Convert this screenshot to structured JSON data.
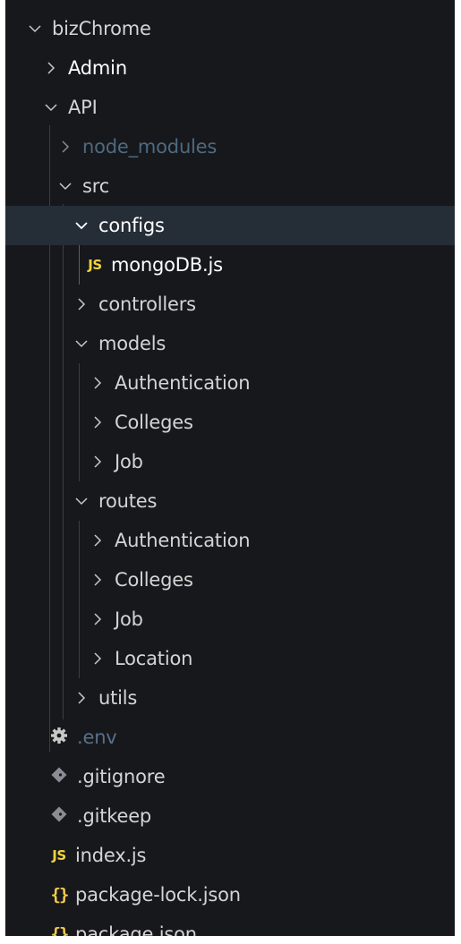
{
  "explorer": {
    "items": [
      {
        "label": "bizChrome",
        "type": "folder",
        "expanded": true
      },
      {
        "label": "Admin",
        "type": "folder",
        "expanded": false
      },
      {
        "label": "API",
        "type": "folder",
        "expanded": true
      },
      {
        "label": "node_modules",
        "type": "folder",
        "expanded": false
      },
      {
        "label": "src",
        "type": "folder",
        "expanded": true
      },
      {
        "label": "configs",
        "type": "folder",
        "expanded": true,
        "selected": true
      },
      {
        "label": "mongoDB.js",
        "type": "file",
        "icon": "js-file-icon",
        "icon_text": "JS"
      },
      {
        "label": "controllers",
        "type": "folder",
        "expanded": false
      },
      {
        "label": "models",
        "type": "folder",
        "expanded": true
      },
      {
        "label": "Authentication",
        "type": "folder",
        "expanded": false
      },
      {
        "label": "Colleges",
        "type": "folder",
        "expanded": false
      },
      {
        "label": "Job",
        "type": "folder",
        "expanded": false
      },
      {
        "label": "routes",
        "type": "folder",
        "expanded": true
      },
      {
        "label": "Authentication",
        "type": "folder",
        "expanded": false
      },
      {
        "label": "Colleges",
        "type": "folder",
        "expanded": false
      },
      {
        "label": "Job",
        "type": "folder",
        "expanded": false
      },
      {
        "label": "Location",
        "type": "folder",
        "expanded": false
      },
      {
        "label": "utils",
        "type": "folder",
        "expanded": false
      },
      {
        "label": ".env",
        "type": "file",
        "icon": "gear-icon"
      },
      {
        "label": ".gitignore",
        "type": "file",
        "icon": "git-diamond-icon"
      },
      {
        "label": ".gitkeep",
        "type": "file",
        "icon": "git-diamond-icon"
      },
      {
        "label": "index.js",
        "type": "file",
        "icon": "js-file-icon",
        "icon_text": "JS"
      },
      {
        "label": "package-lock.json",
        "type": "file",
        "icon": "json-file-icon",
        "icon_text": "{}"
      },
      {
        "label": "package.json",
        "type": "file",
        "icon": "json-file-icon",
        "icon_text": "{}"
      }
    ]
  },
  "colors": {
    "background": "#17181c",
    "selected_row": "#252d37",
    "text": "#d4d4d4",
    "dim_text": "#4d6a80",
    "js_icon": "#f3d33d",
    "json_icon": "#f3c94a"
  }
}
